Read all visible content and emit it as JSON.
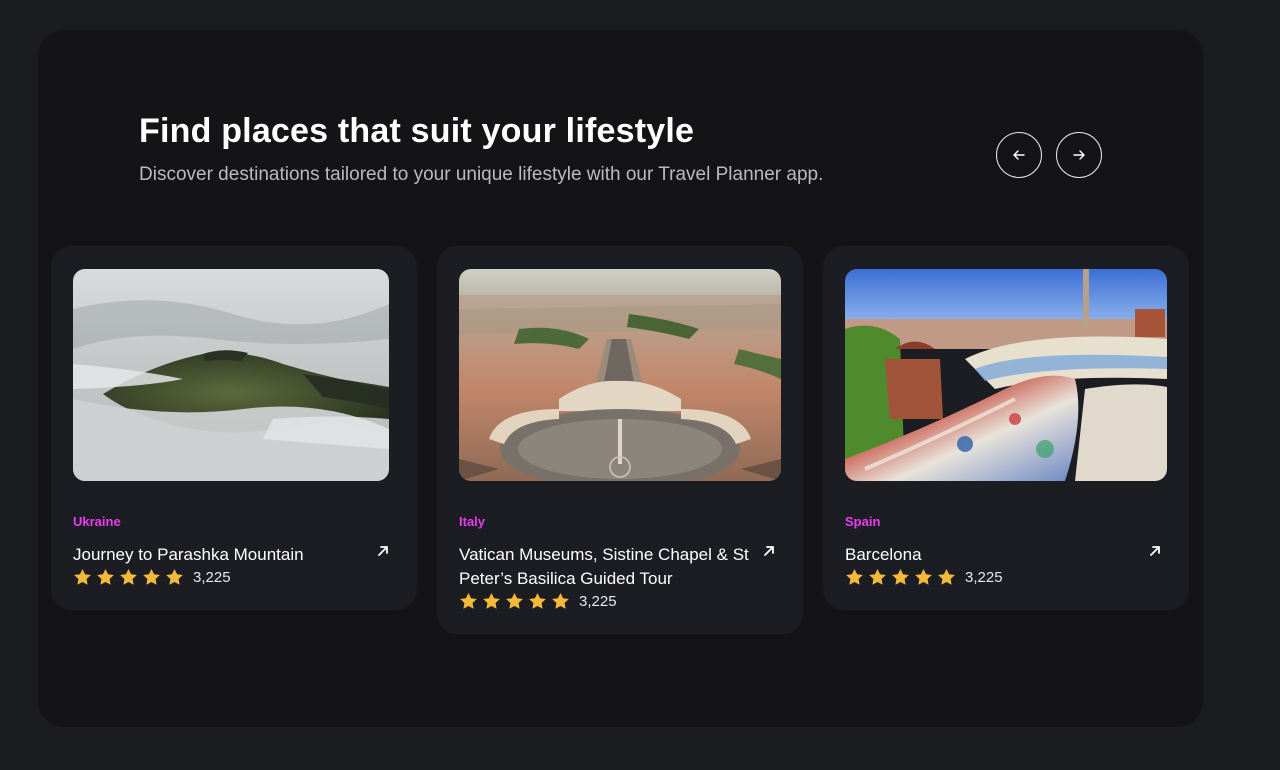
{
  "header": {
    "title": "Find places that suit your lifestyle",
    "subtitle": "Discover destinations tailored to your unique lifestyle with our Travel Planner app."
  },
  "nav": {
    "prev_icon": "arrow-left-icon",
    "next_icon": "arrow-right-icon"
  },
  "colors": {
    "accent": "#e83df0",
    "star": "#f5b93a",
    "card_bg": "#1c1d22",
    "panel_bg": "#141416"
  },
  "cards": [
    {
      "country": "Ukraine",
      "title": "Journey to Parashka Mountain",
      "rating": 5,
      "reviews": "3,225",
      "image": "misty-mountain-photo"
    },
    {
      "country": "Italy",
      "title": "Vatican Museums, Sistine Chapel & St Peter’s Basilica Guided Tour",
      "rating": 5,
      "reviews": "3,225",
      "image": "st-peters-square-photo"
    },
    {
      "country": "Spain",
      "title": "Barcelona",
      "rating": 5,
      "reviews": "3,225",
      "image": "park-guell-photo"
    }
  ]
}
